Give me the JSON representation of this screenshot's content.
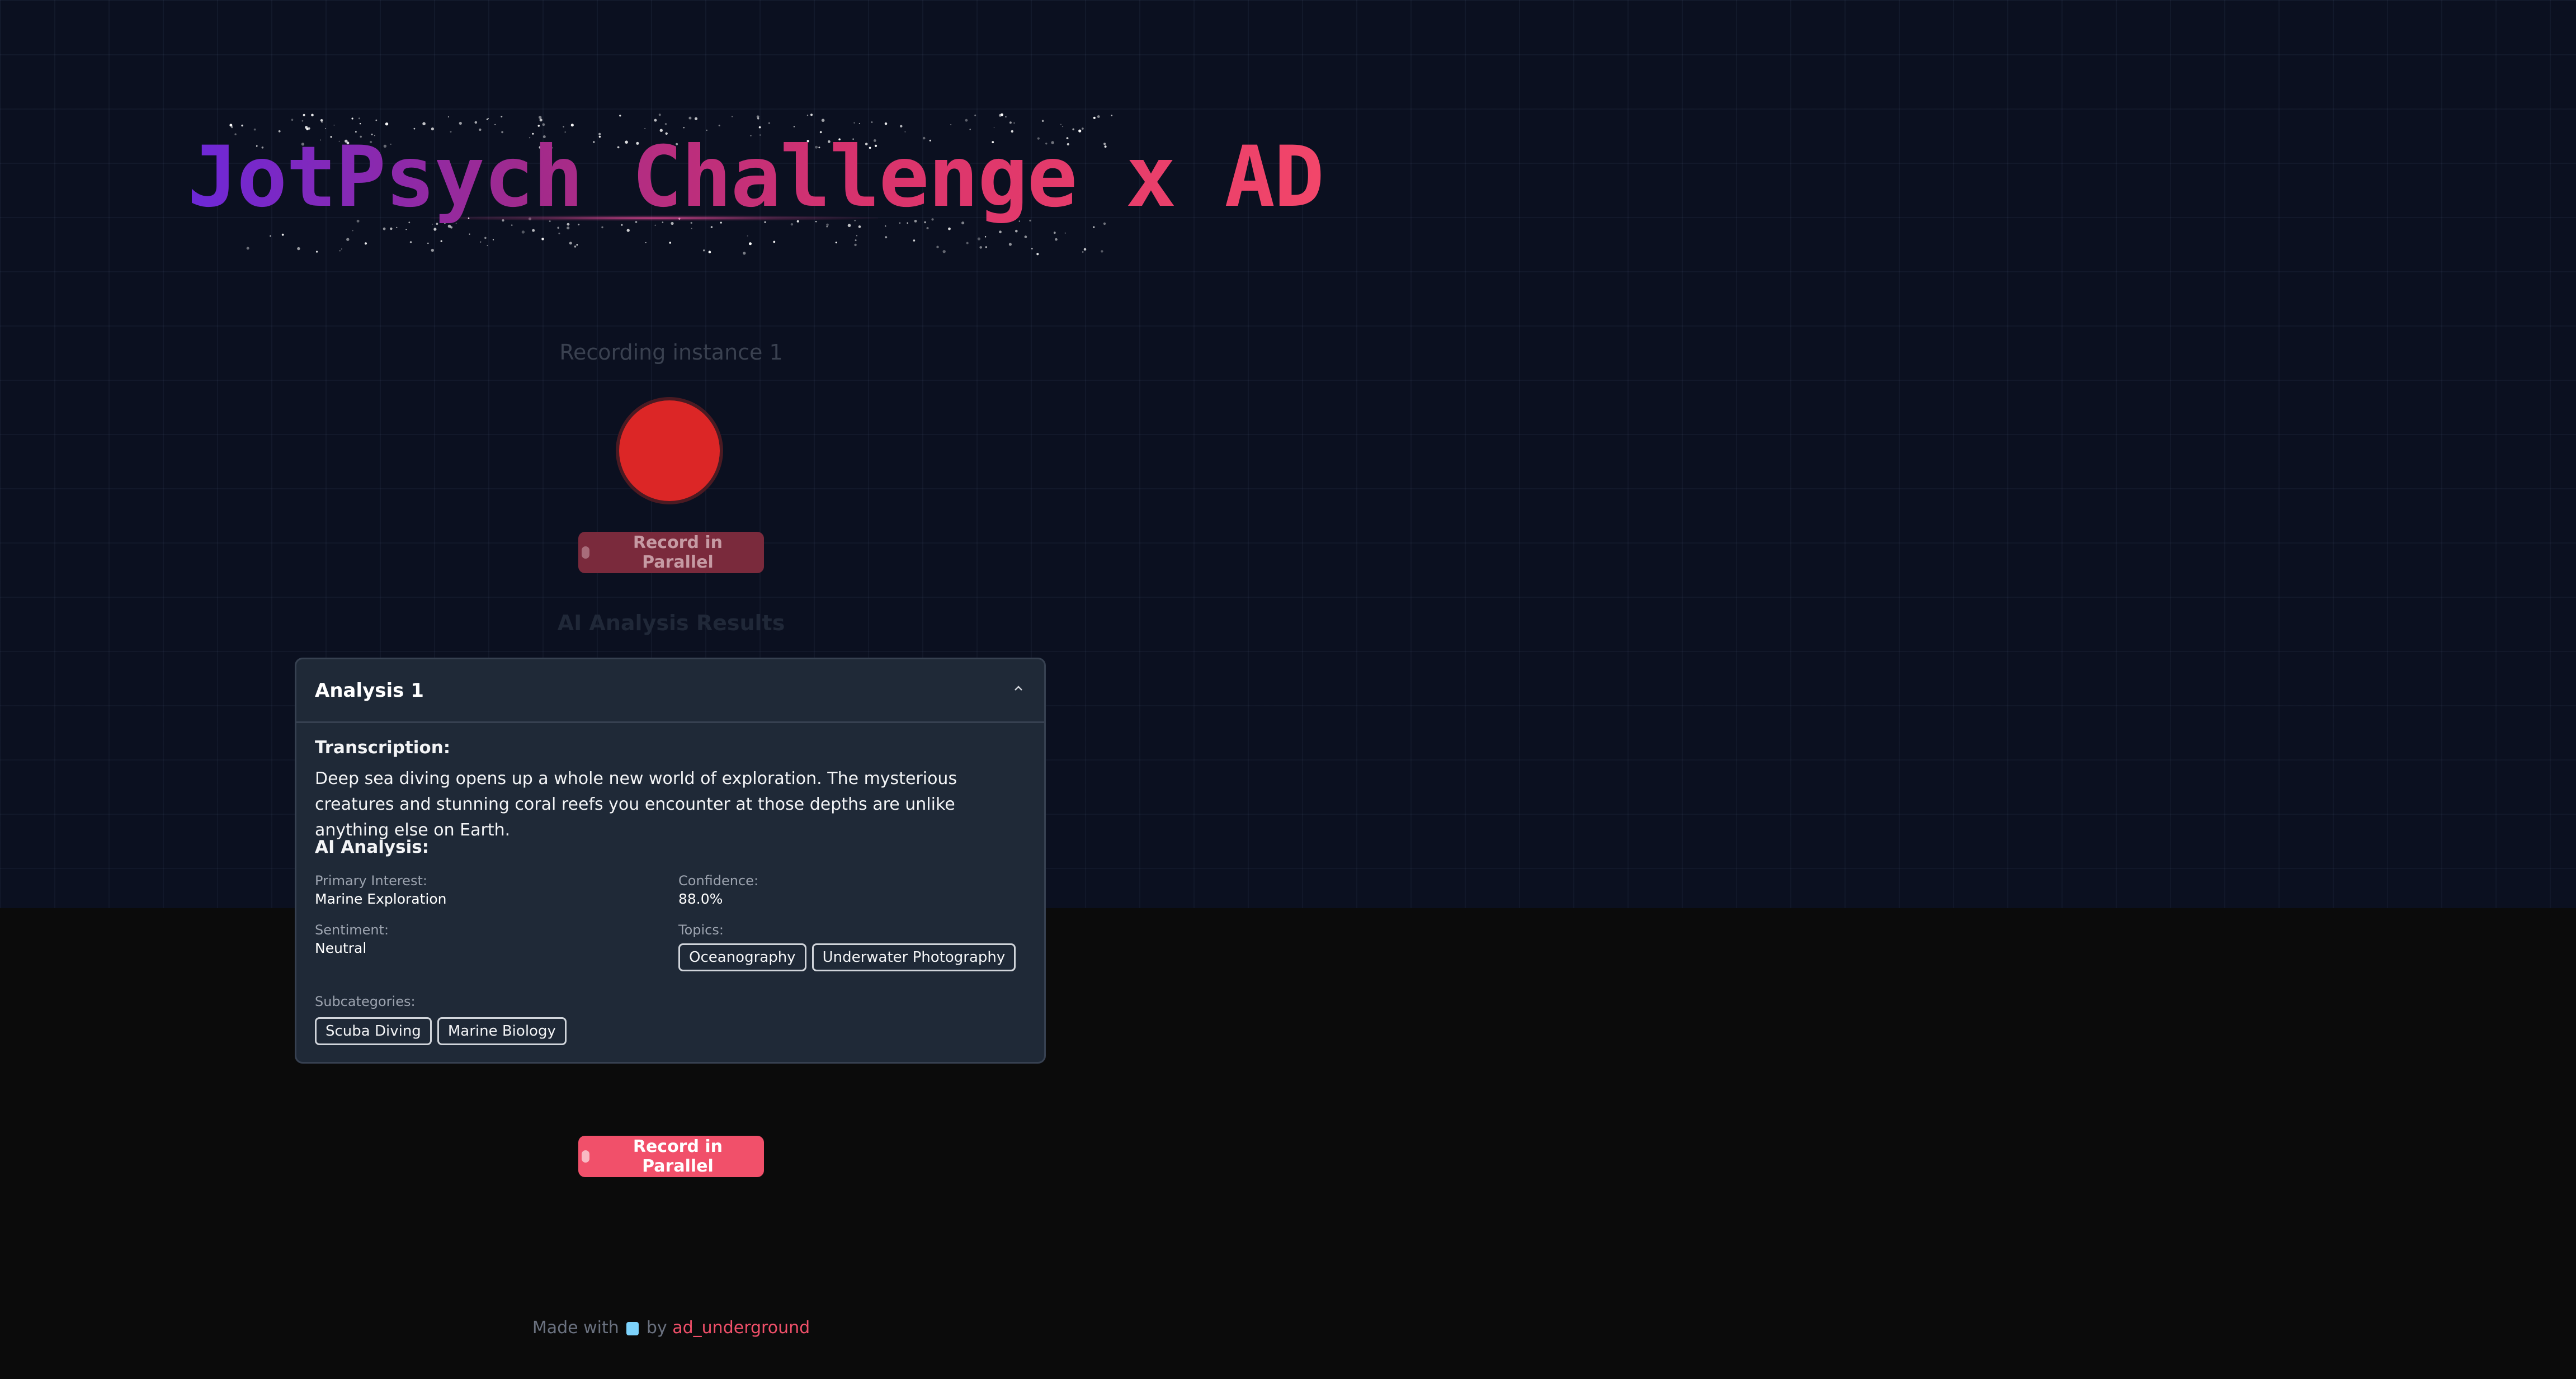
{
  "header": {
    "title": "JotPsych Challenge x AD"
  },
  "recorder": {
    "instance_label": "Recording instance 1",
    "parallel_button_label": "Record in Parallel"
  },
  "results": {
    "heading": "AI Analysis Results",
    "analysis": {
      "title": "Analysis 1",
      "transcription_label": "Transcription:",
      "transcription": "Deep sea diving opens up a whole new world of exploration. The mysterious creatures and stunning coral reefs you encounter at those depths are unlike anything else on Earth.",
      "ai_analysis_label": "AI Analysis:",
      "primary_interest_label": "Primary Interest:",
      "primary_interest": "Marine Exploration",
      "confidence_label": "Confidence:",
      "confidence": "88.0%",
      "sentiment_label": "Sentiment:",
      "sentiment": "Neutral",
      "topics_label": "Topics:",
      "topics": [
        "Oceanography",
        "Underwater Photography"
      ],
      "subcategories_label": "Subcategories:",
      "subcategories": [
        "Scuba Diving",
        "Marine Biology"
      ]
    }
  },
  "bottom_button": {
    "label": "Record in Parallel"
  },
  "footer": {
    "made_with": "Made with",
    "by": "by",
    "author": "ad_underground"
  },
  "icons": {
    "record": "record-circle-icon",
    "mic": "microphone-icon",
    "chevron": "chevron-up-icon",
    "footer": "robot-icon"
  },
  "colors": {
    "accent": "#f1506a",
    "record_red": "#dc2626",
    "card_bg": "#1f2937",
    "title_gradient_start": "#6d28d9",
    "title_gradient_end": "#f2466a"
  }
}
